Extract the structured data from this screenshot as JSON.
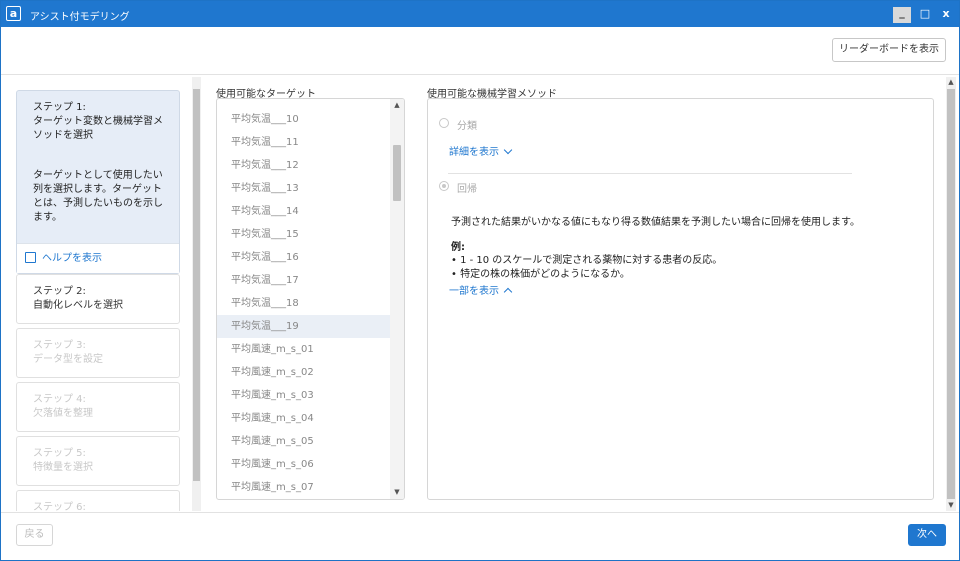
{
  "window": {
    "app_icon": "a",
    "title": "アシスト付モデリング",
    "minimize": "_",
    "maximize": "□",
    "close": "x"
  },
  "header": {
    "leaderboard_button": "リーダーボードを表示"
  },
  "steps": [
    {
      "title": "ステップ 1:",
      "name": "ターゲット変数と機械学習メソッドを選択",
      "description": "ターゲットとして使用したい列を選択します。ターゲットとは、予測したいものを示します。",
      "state": "active"
    },
    {
      "title": "ステップ 2:",
      "name": "自動化レベルを選択",
      "state": "enabled"
    },
    {
      "title": "ステップ 3:",
      "name": "データ型を設定",
      "state": "disabled"
    },
    {
      "title": "ステップ 4:",
      "name": "欠落値を整理",
      "state": "disabled"
    },
    {
      "title": "ステップ 5:",
      "name": "特徴量を選択",
      "state": "disabled"
    },
    {
      "title": "ステップ 6:",
      "name": "",
      "state": "disabled"
    }
  ],
  "help_link": "ヘルプを表示",
  "targets": {
    "label": "使用可能なターゲット",
    "items": [
      "平均気温___10",
      "平均気温___11",
      "平均気温___12",
      "平均気温___13",
      "平均気温___14",
      "平均気温___15",
      "平均気温___16",
      "平均気温___17",
      "平均気温___18",
      "平均気温___19",
      "平均風速_m_s_01",
      "平均風速_m_s_02",
      "平均風速_m_s_03",
      "平均風速_m_s_04",
      "平均風速_m_s_05",
      "平均風速_m_s_06",
      "平均風速_m_s_07"
    ],
    "selected_index": 9
  },
  "methods": {
    "label": "使用可能な機械学習メソッド",
    "classification": {
      "label": "分類",
      "details_link": "詳細を表示"
    },
    "regression": {
      "label": "回帰",
      "description": "予測された結果がいかなる値にもなり得る数値結果を予測したい場合に回帰を使用します。",
      "example_heading": "例:",
      "examples": [
        "• 1 - 10 のスケールで測定される薬物に対する患者の反応。",
        "• 特定の株の株価がどのようになるか。"
      ],
      "less_link": "一部を表示"
    }
  },
  "footer": {
    "back_button": "戻る",
    "next_button": "次へ"
  }
}
